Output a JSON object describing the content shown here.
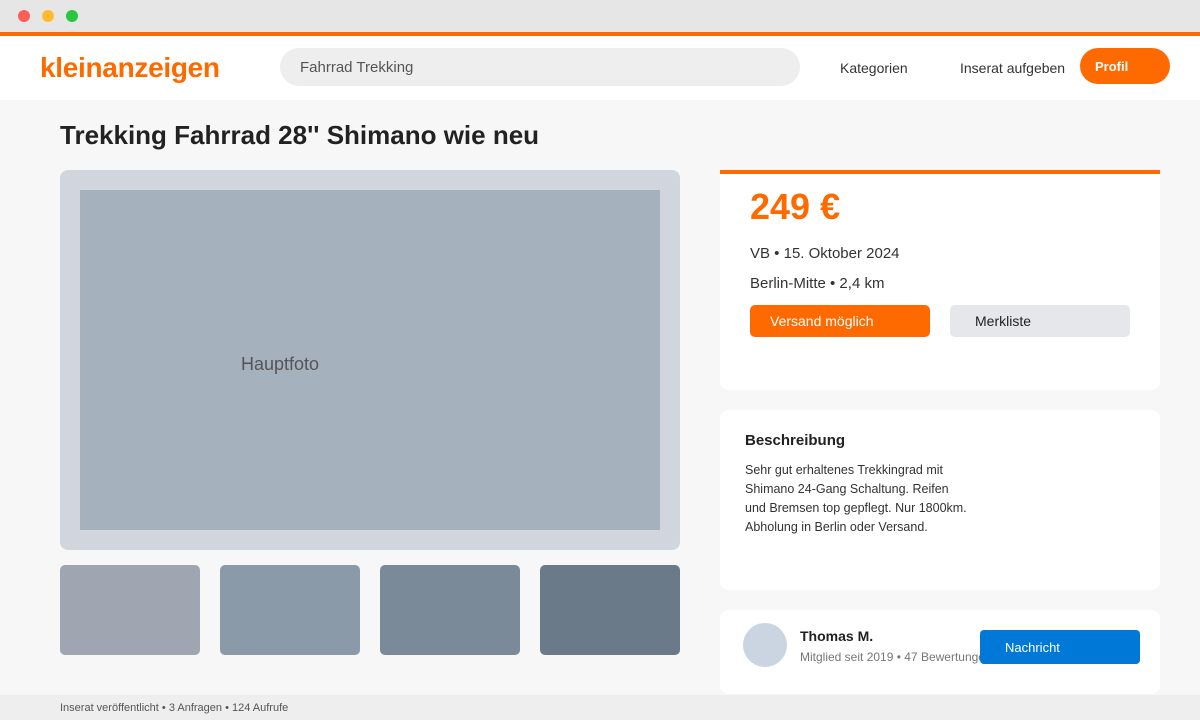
{
  "header": {
    "logo": "kleinanzeigen",
    "search_value": "Fahrrad Trekking",
    "nav_categories": "Kategorien",
    "nav_post_ad": "Inserat aufgeben",
    "profile_label": "Profil"
  },
  "listing": {
    "title": "Trekking Fahrrad 28'' Shimano wie neu",
    "main_photo_label": "Hauptfoto",
    "thumbnail_count": 4
  },
  "price_card": {
    "price": "249 €",
    "meta_line1": "VB • 15. Oktober 2024",
    "meta_line2": "Berlin-Mitte • 2,4 km",
    "shipping_button": "Versand möglich",
    "watchlist_button": "Merkliste"
  },
  "description": {
    "heading": "Beschreibung",
    "lines": [
      "Sehr gut erhaltenes Trekkingrad mit",
      "Shimano 24-Gang Schaltung. Reifen",
      "und Bremsen top gepflegt. Nur 1800km.",
      "Abholung in Berlin oder Versand."
    ]
  },
  "seller": {
    "name": "Thomas M.",
    "meta": "Mitglied seit 2019 • 47 Bewertungen",
    "message_button": "Nachricht"
  },
  "footer": {
    "stats": "Inserat veröffentlicht • 3 Anfragen • 124 Aufrufe"
  },
  "colors": {
    "brand": "#ff6a00",
    "message_button": "#0078d7"
  }
}
